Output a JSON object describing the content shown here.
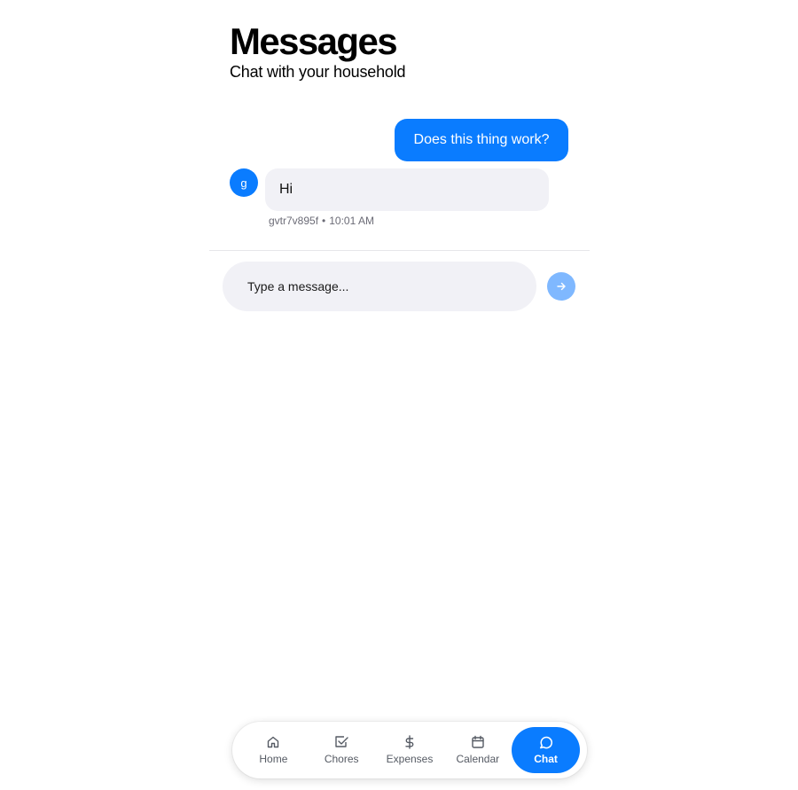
{
  "header": {
    "title": "Messages",
    "subtitle": "Chat with your household"
  },
  "messages": [
    {
      "direction": "outgoing",
      "text": "Does this thing work?"
    },
    {
      "direction": "incoming",
      "avatar_initial": "g",
      "text": "Hi",
      "sender": "gvtr7v895f",
      "separator": "•",
      "time": "10:01 AM"
    }
  ],
  "composer": {
    "placeholder": "Type a message...",
    "send_icon": "arrow-right-icon"
  },
  "nav": {
    "items": [
      {
        "label": "Home",
        "icon": "home-icon",
        "active": false
      },
      {
        "label": "Chores",
        "icon": "checkbox-icon",
        "active": false
      },
      {
        "label": "Expenses",
        "icon": "dollar-icon",
        "active": false
      },
      {
        "label": "Calendar",
        "icon": "calendar-icon",
        "active": false
      },
      {
        "label": "Chat",
        "icon": "chat-bubble-icon",
        "active": true
      }
    ]
  },
  "colors": {
    "accent": "#0a7cff",
    "bubble_incoming": "#f1f1f6",
    "send_disabled": "#7fb8ff"
  }
}
